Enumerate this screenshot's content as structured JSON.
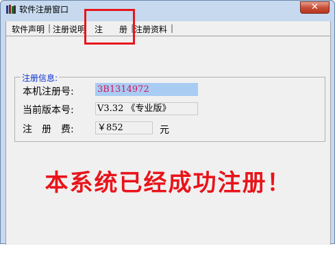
{
  "window": {
    "title": "软件注册窗口",
    "close_label": "✕"
  },
  "tabs": [
    {
      "label": "软件声明",
      "active": false
    },
    {
      "label": "注册说明",
      "active": false
    },
    {
      "label": "注　　册",
      "active": true
    },
    {
      "label": "注册资料",
      "active": false
    }
  ],
  "registration": {
    "legend": "注册信息:",
    "machine_code_label": "本机注册号:",
    "machine_code_value": "3B1314972",
    "version_label": "当前版本号:",
    "version_value": "V3.32 《专业版》",
    "fee_label": "注　册　费:",
    "fee_value": "￥852",
    "fee_unit": "元"
  },
  "status_message": "本系统已经成功注册！",
  "colors": {
    "accent_red": "#e8141a",
    "legend_blue": "#0a2fcf",
    "selection_blue": "#a9ccf3"
  }
}
